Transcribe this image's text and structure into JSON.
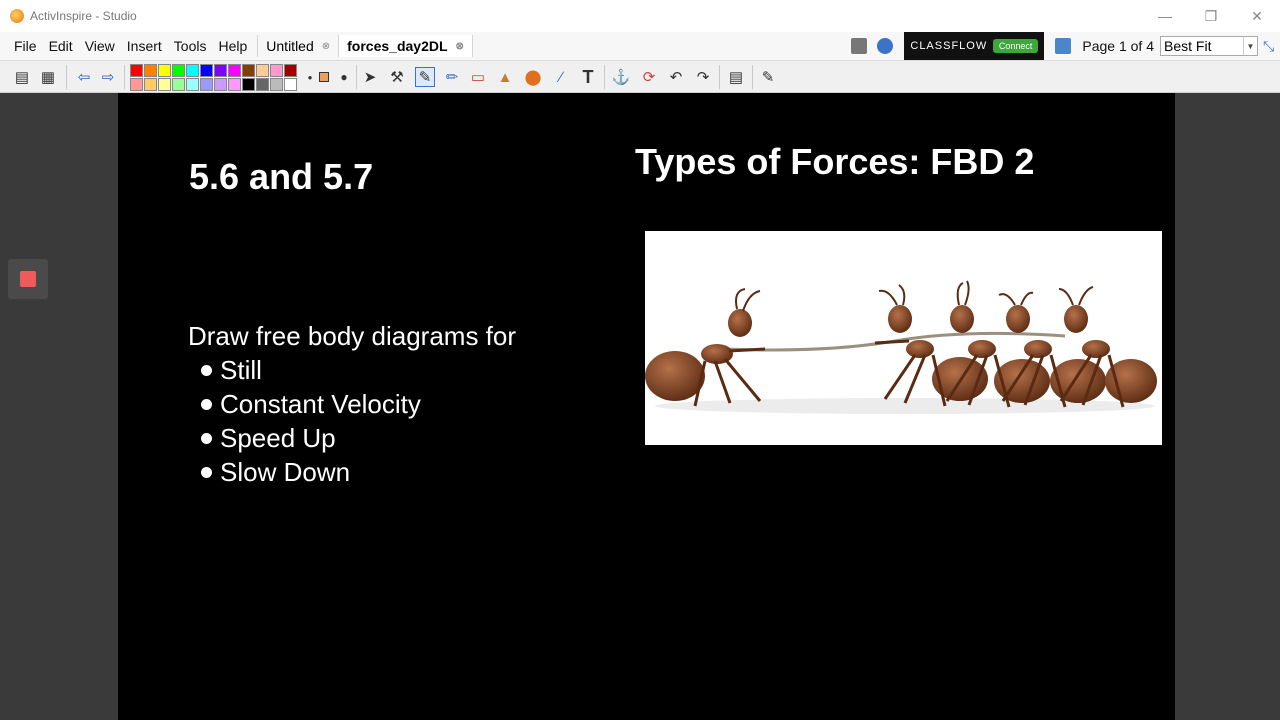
{
  "window": {
    "title": "ActivInspire - Studio",
    "min_icon": "minimize-icon",
    "restore_icon": "restore-icon",
    "close_icon": "close-icon"
  },
  "menubar": {
    "items": [
      "File",
      "Edit",
      "View",
      "Insert",
      "Tools",
      "Help"
    ],
    "tabs": [
      {
        "label": "Untitled",
        "active": false
      },
      {
        "label": "forces_day2DL",
        "active": true
      }
    ],
    "classflow_logo": "CLASSFLOW",
    "classflow_connect": "Connect",
    "page_info": "Page 1 of 4",
    "zoom_value": "Best Fit"
  },
  "toolbar": {
    "colors_row1": [
      "#ff0000",
      "#ff8000",
      "#ffff00",
      "#00ff00",
      "#00ffff",
      "#0000ff",
      "#8000ff",
      "#ff00ff",
      "#804000",
      "#ffcc99",
      "#ff99cc",
      "#a00000"
    ],
    "colors_row2": [
      "#ff9999",
      "#ffcc66",
      "#ffff99",
      "#99ff99",
      "#99ffff",
      "#9999ff",
      "#cc99ff",
      "#ff99ff",
      "#000000",
      "#666666",
      "#bbbbbb",
      "#ffffff"
    ]
  },
  "slide": {
    "section_number": "5.6 and 5.7",
    "title": "Types of Forces: FBD 2",
    "instruction": "Draw free body diagrams for",
    "bullets": [
      "Still",
      "Constant Velocity",
      "Speed Up",
      "Slow Down"
    ],
    "image_subject": "ants-tug-of-war-picture"
  }
}
